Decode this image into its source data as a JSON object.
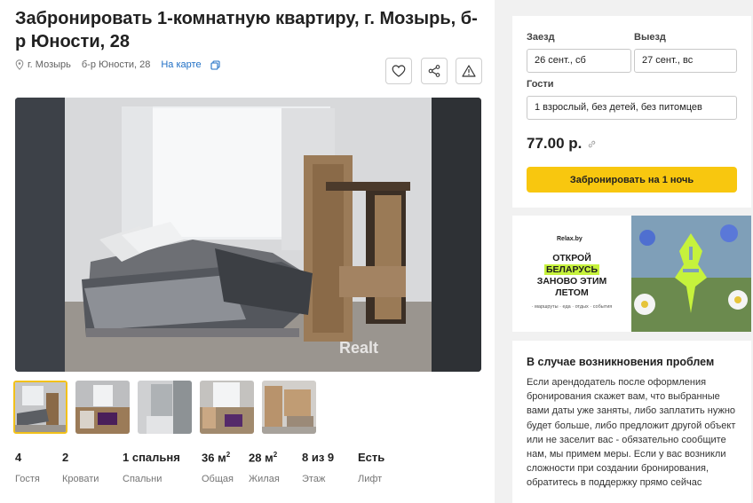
{
  "listing": {
    "title": "Забронировать 1-комнатную квартиру, г. Мозырь, б-р Юности, 28",
    "city": "г. Мозырь",
    "street": "б-р Юности, 28",
    "map_link": "На карте"
  },
  "photo": {
    "watermark": "Realt"
  },
  "stats": [
    {
      "value": "4",
      "label": "Гостя"
    },
    {
      "value": "2",
      "label": "Кровати"
    },
    {
      "value": "1 спальня",
      "label": "Спальни"
    },
    {
      "value": "36 м",
      "sup": "2",
      "label": "Общая"
    },
    {
      "value": "28 м",
      "sup": "2",
      "label": "Жилая"
    },
    {
      "value": "8 из 9",
      "label": "Этаж"
    },
    {
      "value": "Есть",
      "label": "Лифт"
    }
  ],
  "booking": {
    "checkin_label": "Заезд",
    "checkout_label": "Выезд",
    "checkin_value": "26 сент., сб",
    "checkout_value": "27 сент., вс",
    "guests_label": "Гости",
    "guests_value": "1 взрослый, без детей, без питомцев",
    "price": "77.00 р.",
    "book_button": "Забронировать на 1 ночь"
  },
  "ad": {
    "brand": "Relax.by",
    "line1": "ОТКРОЙ",
    "line2": "БЕЛАРУСЬ",
    "line3": "ЗАНОВО ЭТИМ",
    "line4": "ЛЕТОМ",
    "sub": "· маршруты · еда · отдых · события"
  },
  "help": {
    "title": "В случае возникновения проблем",
    "text": "Если арендодатель после оформления бронирования скажет вам, что выбранные вами даты уже заняты, либо заплатить нужно будет больше, либо предложит другой объект или не заселит вас - обязательно сообщите нам, мы примем меры. Если у вас возникли сложности при создании бронирования, обратитесь в поддержку прямо сейчас"
  },
  "colors": {
    "accent": "#f8c70f",
    "link": "#1f6fc5",
    "ad_highlight": "#c6f23c"
  }
}
